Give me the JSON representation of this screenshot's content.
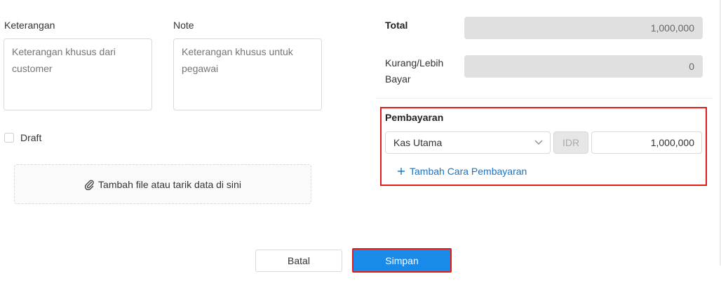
{
  "left": {
    "keterangan_label": "Keterangan",
    "keterangan_placeholder": "Keterangan khusus dari customer",
    "note_label": "Note",
    "note_placeholder": "Keterangan khusus untuk pegawai",
    "draft_label": "Draft",
    "dropzone_text": "Tambah file atau tarik data di sini"
  },
  "summary": {
    "total_label": "Total",
    "total_value": "1,000,000",
    "kurang_label": "Kurang/Lebih Bayar",
    "kurang_value": "0"
  },
  "payment": {
    "title": "Pembayaran",
    "method": "Kas Utama",
    "currency": "IDR",
    "amount": "1,000,000",
    "add_label": "Tambah Cara Pembayaran"
  },
  "actions": {
    "cancel_label": "Batal",
    "save_label": "Simpan"
  },
  "colors": {
    "accent": "#1a8ae8",
    "highlight": "#e01c1c",
    "link": "#1a73c8",
    "readonly_bg": "#e0e0e0"
  }
}
